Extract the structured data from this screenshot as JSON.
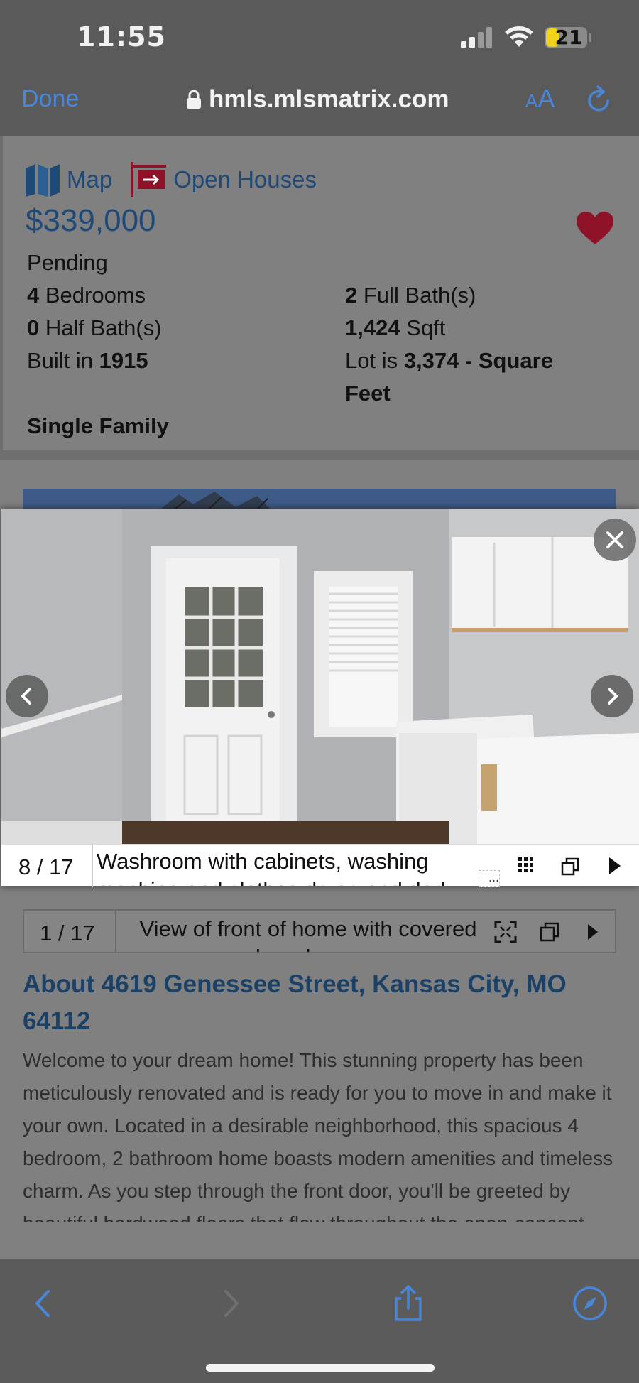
{
  "status_bar": {
    "time": "11:55",
    "battery_level": "21",
    "battery_color": "#f2d31b"
  },
  "browser": {
    "done_label": "Done",
    "url": "hmls.mlsmatrix.com",
    "text_size_label_small": "A",
    "text_size_label_large": "A",
    "accent_color": "#4a86d8"
  },
  "listing": {
    "map_link": "Map",
    "open_houses_link": "Open Houses",
    "price": "$339,000",
    "status": "Pending",
    "bedrooms_value": "4",
    "bedrooms_label": "Bedrooms",
    "full_baths_value": "2",
    "full_baths_label": "Full Bath(s)",
    "half_baths_value": "0",
    "half_baths_label": "Half Bath(s)",
    "sqft_value": "1,424",
    "sqft_label": "Sqft",
    "built_label": "Built in",
    "built_value": "1915",
    "lot_label": "Lot is",
    "lot_value_line1": "3,374 - Square",
    "lot_value_line2": "Feet",
    "property_type": "Single Family"
  },
  "background_gallery": {
    "counter": "1 / 17",
    "caption": "View of front of home with covered porch and a garage"
  },
  "about": {
    "title": "About 4619 Genessee Street, Kansas City, MO 64112",
    "description": "Welcome to your dream home! This stunning property has been meticulously renovated and is ready for you to move in and make it your own. Located in a desirable neighborhood, this spacious 4 bedroom, 2 bathroom home boasts modern amenities and timeless charm. As you step through the front door, you'll be greeted by beautiful hardwood floors that flow throughout the open-concept living space. The kitchen is a"
  },
  "lightbox": {
    "counter": "8 / 17",
    "caption": "Washroom with cabinets, washing machine and clothes dryer, and dark",
    "more_glyph": "..."
  },
  "icons": {
    "map": "map-icon",
    "open_houses": "open-house-sign-icon",
    "favorite": "heart-icon",
    "grid": "grid-icon",
    "popout": "popout-icon",
    "play": "play-icon",
    "fullscreen": "fullscreen-icon",
    "close": "close-icon",
    "prev": "chevron-left-icon",
    "next": "chevron-right-icon",
    "back": "back-icon",
    "forward": "forward-icon",
    "share": "share-icon",
    "compass": "compass-icon"
  },
  "colors": {
    "link_blue": "#1f4a78",
    "favorite_red": "#8e1228"
  }
}
